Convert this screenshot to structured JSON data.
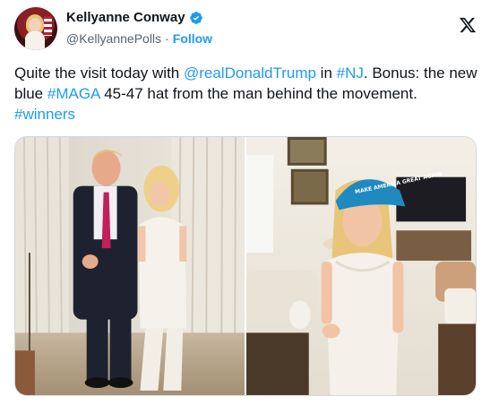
{
  "author": {
    "name": "Kellyanne Conway",
    "handle": "@KellyannePolls",
    "separator": "·",
    "follow_label": "Follow",
    "avatar_icon": "profile-avatar",
    "verified_icon": "verified-badge-icon"
  },
  "platform_icon": "x-logo-icon",
  "tweet": {
    "t1": "Quite the visit today with ",
    "m1": "@realDonaldTrump",
    "t2": " in ",
    "h1": "#NJ",
    "t3": ". Bonus: the new blue ",
    "h2": "#MAGA",
    "t4": " 45-47 hat from the man behind the movement. ",
    "h3": "#winners"
  },
  "media": {
    "photos": [
      {
        "subject": "photo-two-people-standing"
      },
      {
        "subject": "photo-woman-blue-hat"
      }
    ],
    "hat_text": "MAKE AMERICA GREAT AGAIN"
  },
  "colors": {
    "accent": "#1d9bf0",
    "text": "#0f1419",
    "muted": "#536471"
  }
}
